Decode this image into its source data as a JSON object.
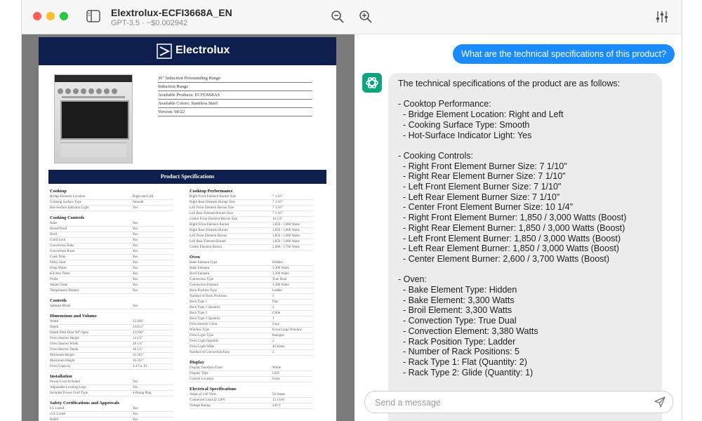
{
  "window": {
    "title": "Elextrolux-ECFI3668A_EN",
    "subtitle": "GPT-3.5 · ~$0.002942"
  },
  "pdf": {
    "brand": "Electrolux",
    "info": [
      "36\" Induction Freestanding Range",
      "Induction Range",
      "Available Products: ECFI3668AS",
      "Available Colors: Stainless Steel",
      "Version: 08/22"
    ],
    "banner": "Product Specifications",
    "left_sections": [
      {
        "title": "Cooktop",
        "rows": [
          {
            "k": "Bridge Element Location",
            "v": "Right and Left"
          },
          {
            "k": "Cooking Surface Type",
            "v": "Smooth"
          },
          {
            "k": "Hot-Surface Indicator Light",
            "v": "Yes"
          }
        ]
      },
      {
        "title": "Cooking Controls",
        "rows": [
          {
            "k": "Bake",
            "v": "Yes"
          },
          {
            "k": "Bread Proof",
            "v": "Yes"
          },
          {
            "k": "Broil",
            "v": "Yes"
          },
          {
            "k": "Child Lock",
            "v": "Yes"
          },
          {
            "k": "Convection Bake",
            "v": "Yes"
          },
          {
            "k": "Convection Roast",
            "v": "Yes"
          },
          {
            "k": "Cook Time",
            "v": "Yes"
          },
          {
            "k": "Delay Start",
            "v": "Yes"
          },
          {
            "k": "Keep Warm",
            "v": "Yes"
          },
          {
            "k": "Kitchen Timer",
            "v": "Yes"
          },
          {
            "k": "Probe",
            "v": "Yes"
          },
          {
            "k": "Steam Clean",
            "v": "Yes"
          },
          {
            "k": "Temperature Display",
            "v": "Yes"
          }
        ]
      },
      {
        "title": "Controls",
        "rows": [
          {
            "k": "Sabbath Mode",
            "v": "Yes"
          }
        ]
      },
      {
        "title": "Dimensions and Volume",
        "rows": [
          {
            "k": "Width",
            "v": "35.938\""
          },
          {
            "k": "Depth",
            "v": "24.813\""
          },
          {
            "k": "Depth With Door 90° Open",
            "v": "43.938\""
          },
          {
            "k": "Oven Interior Height",
            "v": "14 1/2\""
          },
          {
            "k": "Oven Interior Width",
            "v": "28 1/4\""
          },
          {
            "k": "Oven Interior Depth",
            "v": "18 1/2\""
          },
          {
            "k": "Minimum Height",
            "v": "35.563\""
          },
          {
            "k": "Maximum Height",
            "v": "36.563\""
          },
          {
            "k": "Oven Capacity",
            "v": "4.4 Cu. Ft."
          }
        ]
      },
      {
        "title": "Installation",
        "rows": [
          {
            "k": "Power Cord Included",
            "v": "Yes"
          },
          {
            "k": "Adjustable Leveling Legs",
            "v": "Yes"
          },
          {
            "k": "Included Power Cord Type",
            "v": "4-Prong Plug"
          }
        ]
      },
      {
        "title": "Safety Certifications and Approvals",
        "rows": [
          {
            "k": "UL Listed",
            "v": "Yes"
          },
          {
            "k": "cUL Listed",
            "v": "Yes"
          },
          {
            "k": "RoHS",
            "v": "Yes"
          }
        ]
      }
    ],
    "right_sections": [
      {
        "title": "Cooktop Performance",
        "rows": [
          {
            "k": "Right Front Element Burner Size",
            "v": "7 1/10\""
          },
          {
            "k": "Right Rear Element Burner Size",
            "v": "7 1/10\""
          },
          {
            "k": "Left Front Element Burner Size",
            "v": "7 1/10\""
          },
          {
            "k": "Left Rear Element Burner Size",
            "v": "7 1/10\""
          },
          {
            "k": "Center Front Element Burner Size",
            "v": "10 1/4\""
          },
          {
            "k": "Right Front Element Burner",
            "v": "1,850 / 3,000 Watts"
          },
          {
            "k": "Right Rear Element Burner",
            "v": "1,850 / 3,000 Watts"
          },
          {
            "k": "Left Front Element Burner",
            "v": "1,850 / 3,000 Watts"
          },
          {
            "k": "Left Rear Element Burner",
            "v": "1,850 / 3,000 Watts"
          },
          {
            "k": "Center Element Burner",
            "v": "2,600 / 3,700 Watts"
          }
        ]
      },
      {
        "title": "Oven",
        "rows": [
          {
            "k": "Bake Element Type",
            "v": "Hidden"
          },
          {
            "k": "Bake Element",
            "v": "3,300 Watts"
          },
          {
            "k": "Broil Element",
            "v": "3,300 Watts"
          },
          {
            "k": "Convection Type",
            "v": "True Dual"
          },
          {
            "k": "Convection Element",
            "v": "3,380 Watts"
          },
          {
            "k": "Rack Position Type",
            "v": "Ladder"
          },
          {
            "k": "Number of Rack Positions",
            "v": "5"
          },
          {
            "k": "Rack Type 1",
            "v": "Flat"
          },
          {
            "k": "Rack Type 1 Quantity",
            "v": "2"
          },
          {
            "k": "Rack Type 2",
            "v": "Glide"
          },
          {
            "k": "Rack Type 2 Quantity",
            "v": "1"
          },
          {
            "k": "Oven Interior Color",
            "v": "Gray"
          },
          {
            "k": "Window Type",
            "v": "Extra Large Window"
          },
          {
            "k": "Oven Light Type",
            "v": "Halogen"
          },
          {
            "k": "Oven Light Quantity",
            "v": "2"
          },
          {
            "k": "Oven Light Watts",
            "v": "40 Watts"
          },
          {
            "k": "Number of Convection Fans",
            "v": "2"
          }
        ]
      },
      {
        "title": "Display",
        "rows": [
          {
            "k": "Display Interface Color",
            "v": "White"
          },
          {
            "k": "Display Type",
            "v": "LED"
          },
          {
            "k": "Control Location",
            "v": "Front"
          }
        ]
      },
      {
        "title": "Electrical Specifications",
        "rows": [
          {
            "k": "Amps @ 240 Volts",
            "v": "50 Amps"
          },
          {
            "k": "Connected Load @ 240V",
            "v": "15.1 kW"
          },
          {
            "k": "Voltage Rating",
            "v": "240 V"
          }
        ]
      }
    ]
  },
  "chat": {
    "user_message": "What are the technical specifications of this product?",
    "assistant_message": "The technical specifications of the product are as follows:\n\n- Cooktop Performance:\n  - Bridge Element Location: Right and Left\n  - Cooking Surface Type: Smooth\n  - Hot-Surface Indicator Light: Yes\n\n- Cooking Controls:\n  - Right Front Element Burner Size: 7 1/10\"\n  - Right Rear Element Burner Size: 7 1/10\"\n  - Left Front Element Burner Size: 7 1/10\"\n  - Left Rear Element Burner Size: 7 1/10\"\n  - Center Front Element Burner Size: 10 1/4\"\n  - Right Front Element Burner: 1,850 / 3,000 Watts (Boost)\n  - Right Rear Element Burner: 1,850 / 3,000 Watts (Boost)\n  - Left Front Element Burner: 1,850 / 3,000 Watts (Boost)\n  - Left Rear Element Burner: 1,850 / 3,000 Watts (Boost)\n  - Center Element Burner: 2,600 / 3,700 Watts (Boost)\n\n- Oven:\n  - Bake Element Type: Hidden\n  - Bake Element: 3,300 Watts\n  - Broil Element: 3,300 Watts\n  - Convection Type: True Dual\n  - Convection Element: 3,380 Watts\n  - Rack Position Type: Ladder\n  - Number of Rack Positions: 5\n  - Rack Type 1: Flat (Quantity: 2)\n  - Rack Type 2: Glide (Quantity: 1)",
    "composer_placeholder": "Send a message"
  },
  "colors": {
    "accent": "#1a8cff",
    "avatar": "#10a37f",
    "pdf_header": "#0e1f4d"
  }
}
